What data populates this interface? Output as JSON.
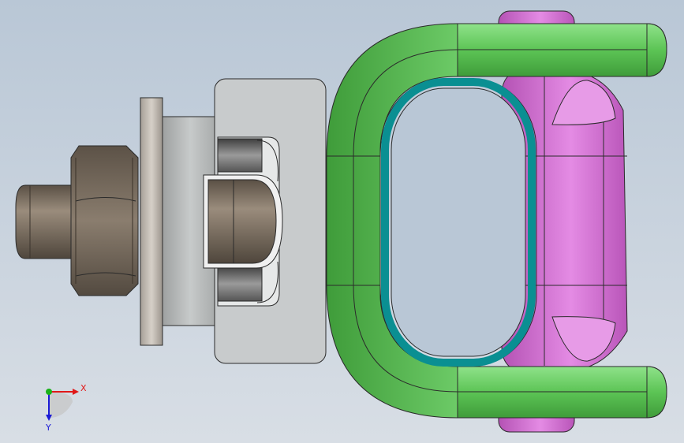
{
  "viewport": {
    "background_top": "#b9c7d6",
    "background_bottom": "#d8dee5"
  },
  "model": {
    "colors": {
      "bolt": "#7d7163",
      "nut": "#77695b",
      "washer": "#c3bdb5",
      "bushing": "#bcbfbf",
      "housing": "#c4c7c8",
      "shackle": "#6fd36a",
      "ring": "#0a8f92",
      "swivel": "#d96fd9",
      "edge": "#2b2b2b"
    }
  },
  "triad": {
    "x_label": "X",
    "y_label": "Y",
    "x_color": "#e01818",
    "y_color": "#1a1ad6",
    "origin_color": "#1ab21a"
  }
}
